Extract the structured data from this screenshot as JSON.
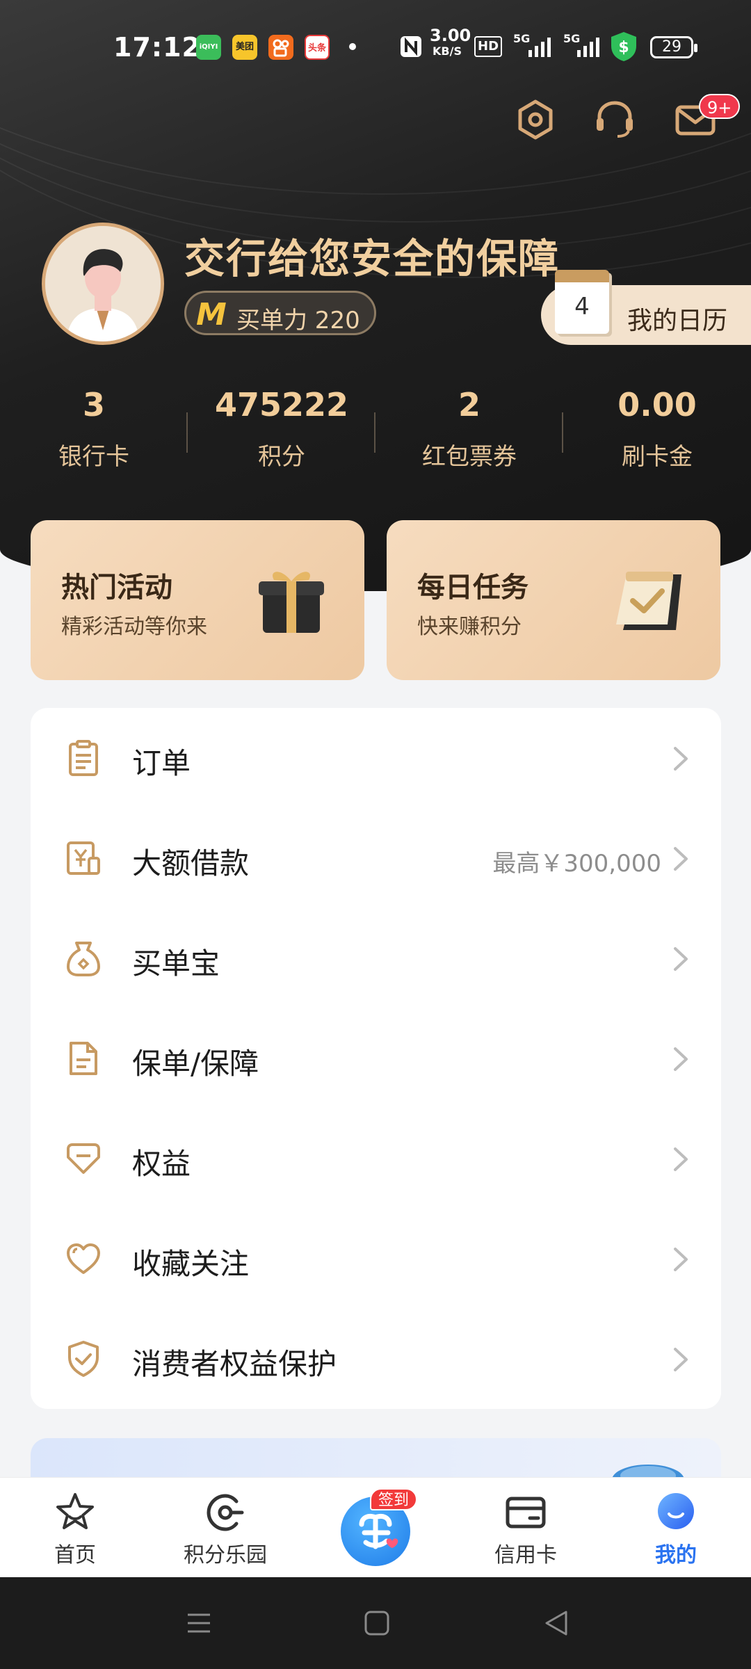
{
  "status_bar": {
    "time": "17:12",
    "apps": [
      {
        "name": "iqiyi",
        "text": "iQIYI",
        "color": "#4fc66a"
      },
      {
        "name": "meituan",
        "text": "美团",
        "color": "#f7c52b"
      },
      {
        "name": "kuaishou",
        "text": "",
        "color": "#f26b1d"
      },
      {
        "name": "toutiao",
        "text": "头条",
        "color": "#e83a3a"
      }
    ],
    "net_speed_value": "3.00",
    "net_speed_unit": "KB/S",
    "hd": "HD",
    "signal1": "5G",
    "signal2": "5G",
    "battery": "29"
  },
  "header": {
    "message_badge": "9+",
    "headline": "交行给您安全的保障",
    "power_m": "M",
    "power_text": "买单力 220",
    "calendar_day": "4",
    "calendar_label": "我的日历"
  },
  "stats": [
    {
      "value": "3",
      "label": "银行卡"
    },
    {
      "value": "475222",
      "label": "积分"
    },
    {
      "value": "2",
      "label": "红包票券"
    },
    {
      "value": "0.00",
      "label": "刷卡金"
    }
  ],
  "promos": [
    {
      "title": "热门活动",
      "subtitle": "精彩活动等你来"
    },
    {
      "title": "每日任务",
      "subtitle": "快来赚积分"
    }
  ],
  "menu": [
    {
      "label": "订单",
      "extra": ""
    },
    {
      "label": "大额借款",
      "extra": "最高￥300,000"
    },
    {
      "label": "买单宝",
      "extra": ""
    },
    {
      "label": "保单/保障",
      "extra": ""
    },
    {
      "label": "权益",
      "extra": ""
    },
    {
      "label": "收藏关注",
      "extra": ""
    },
    {
      "label": "消费者权益保护",
      "extra": ""
    }
  ],
  "tabbar": {
    "home": "首页",
    "points_park": "积分乐园",
    "checkin_badge": "签到",
    "credit_card": "信用卡",
    "mine": "我的"
  },
  "colors": {
    "accent_gold": "#d7a877",
    "active_tab": "#2a73f0",
    "badge_red": "#f0384c"
  }
}
